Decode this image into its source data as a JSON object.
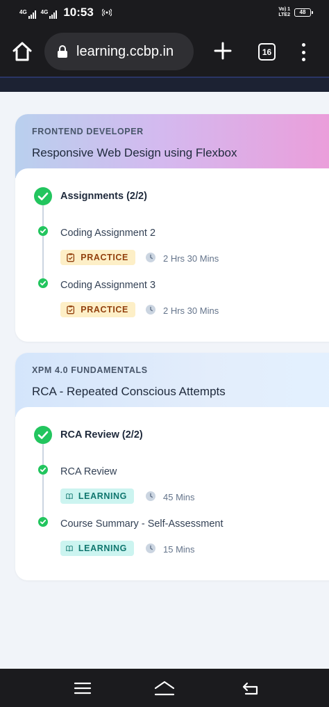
{
  "status_bar": {
    "network1": "4G",
    "network2": "4G",
    "time": "10:53",
    "lte_line1": "Vo) 1",
    "lte_line2": "LTE2",
    "battery": "48"
  },
  "browser": {
    "url": "learning.ccbp.in",
    "tab_count": "16"
  },
  "cards": [
    {
      "category": "FRONTEND DEVELOPER",
      "title": "Responsive Web Design using Flexbox",
      "group_title": "Assignments (2/2)",
      "items": [
        {
          "title": "Coding Assignment 2",
          "tag": "PRACTICE",
          "duration": "2 Hrs 30 Mins"
        },
        {
          "title": "Coding Assignment 3",
          "tag": "PRACTICE",
          "duration": "2 Hrs 30 Mins"
        }
      ]
    },
    {
      "category": "XPM 4.0 FUNDAMENTALS",
      "title": "RCA - Repeated Conscious Attempts",
      "group_title": "RCA Review (2/2)",
      "items": [
        {
          "title": "RCA Review",
          "tag": "LEARNING",
          "duration": "45 Mins"
        },
        {
          "title": "Course Summary - Self-Assessment",
          "tag": "LEARNING",
          "duration": "15 Mins"
        }
      ]
    }
  ],
  "colors": {
    "check_green": "#22c55e",
    "practice_bg": "#fdefc7",
    "learning_bg": "#ccf4f0"
  },
  "icons": [
    "home-icon",
    "lock-icon",
    "plus-icon",
    "tabs-icon",
    "more-vert-icon",
    "check-circle-icon",
    "clipboard-icon",
    "book-icon",
    "clock-icon",
    "menu-icon",
    "nav-home-icon",
    "back-icon"
  ]
}
